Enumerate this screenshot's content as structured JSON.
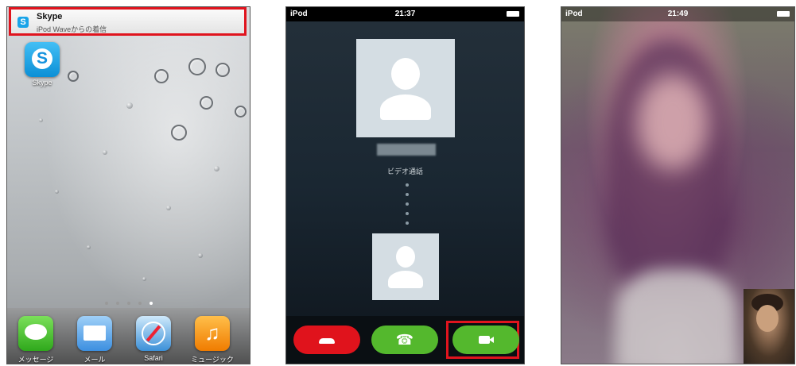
{
  "screen1": {
    "notification": {
      "title": "Skype",
      "subtitle": "iPod Waveからの着信",
      "icon_letter": "S"
    },
    "home_app": {
      "label": "Skype",
      "icon_letter": "S"
    },
    "page_dots": 6,
    "active_dot": 4,
    "dock": [
      {
        "label": "メッセージ",
        "icon": "messages-icon"
      },
      {
        "label": "メール",
        "icon": "mail-icon"
      },
      {
        "label": "Safari",
        "icon": "safari-icon"
      },
      {
        "label": "ミュージック",
        "icon": "music-icon"
      }
    ]
  },
  "screen2": {
    "status": {
      "carrier": "iPod",
      "time": "21:37"
    },
    "call_type": "ビデオ通話",
    "buttons": [
      "hangup-icon",
      "phone-icon",
      "video-camera-icon"
    ],
    "colors": {
      "hangup": "#e0131c",
      "answer": "#54b82d",
      "highlight": "#e0141e"
    }
  },
  "screen3": {
    "status": {
      "carrier": "iPod",
      "time": "21:49"
    }
  }
}
